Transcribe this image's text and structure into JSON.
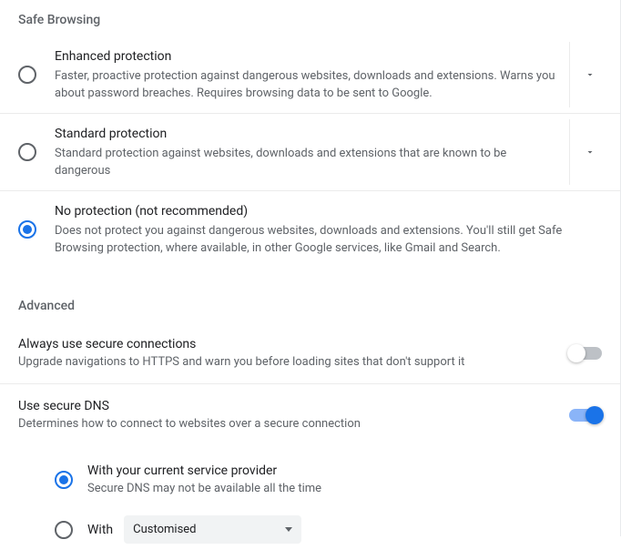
{
  "safe_browsing": {
    "header": "Safe Browsing",
    "options": [
      {
        "title": "Enhanced protection",
        "desc": "Faster, proactive protection against dangerous websites, downloads and extensions. Warns you about password breaches. Requires browsing data to be sent to Google."
      },
      {
        "title": "Standard protection",
        "desc": "Standard protection against websites, downloads and extensions that are known to be dangerous"
      },
      {
        "title": "No protection (not recommended)",
        "desc": "Does not protect you against dangerous websites, downloads and extensions. You'll still get Safe Browsing protection, where available, in other Google services, like Gmail and Search."
      }
    ],
    "selected_index": 2
  },
  "advanced": {
    "header": "Advanced",
    "secure_connections": {
      "title": "Always use secure connections",
      "desc": "Upgrade navigations to HTTPS and warn you before loading sites that don't support it",
      "enabled": false
    },
    "secure_dns": {
      "title": "Use secure DNS",
      "desc": "Determines how to connect to websites over a secure connection",
      "enabled": true,
      "options": [
        {
          "title": "With your current service provider",
          "desc": "Secure DNS may not be available all the time"
        },
        {
          "with_label": "With",
          "dropdown_value": "Customised"
        }
      ],
      "selected_index": 0
    }
  }
}
